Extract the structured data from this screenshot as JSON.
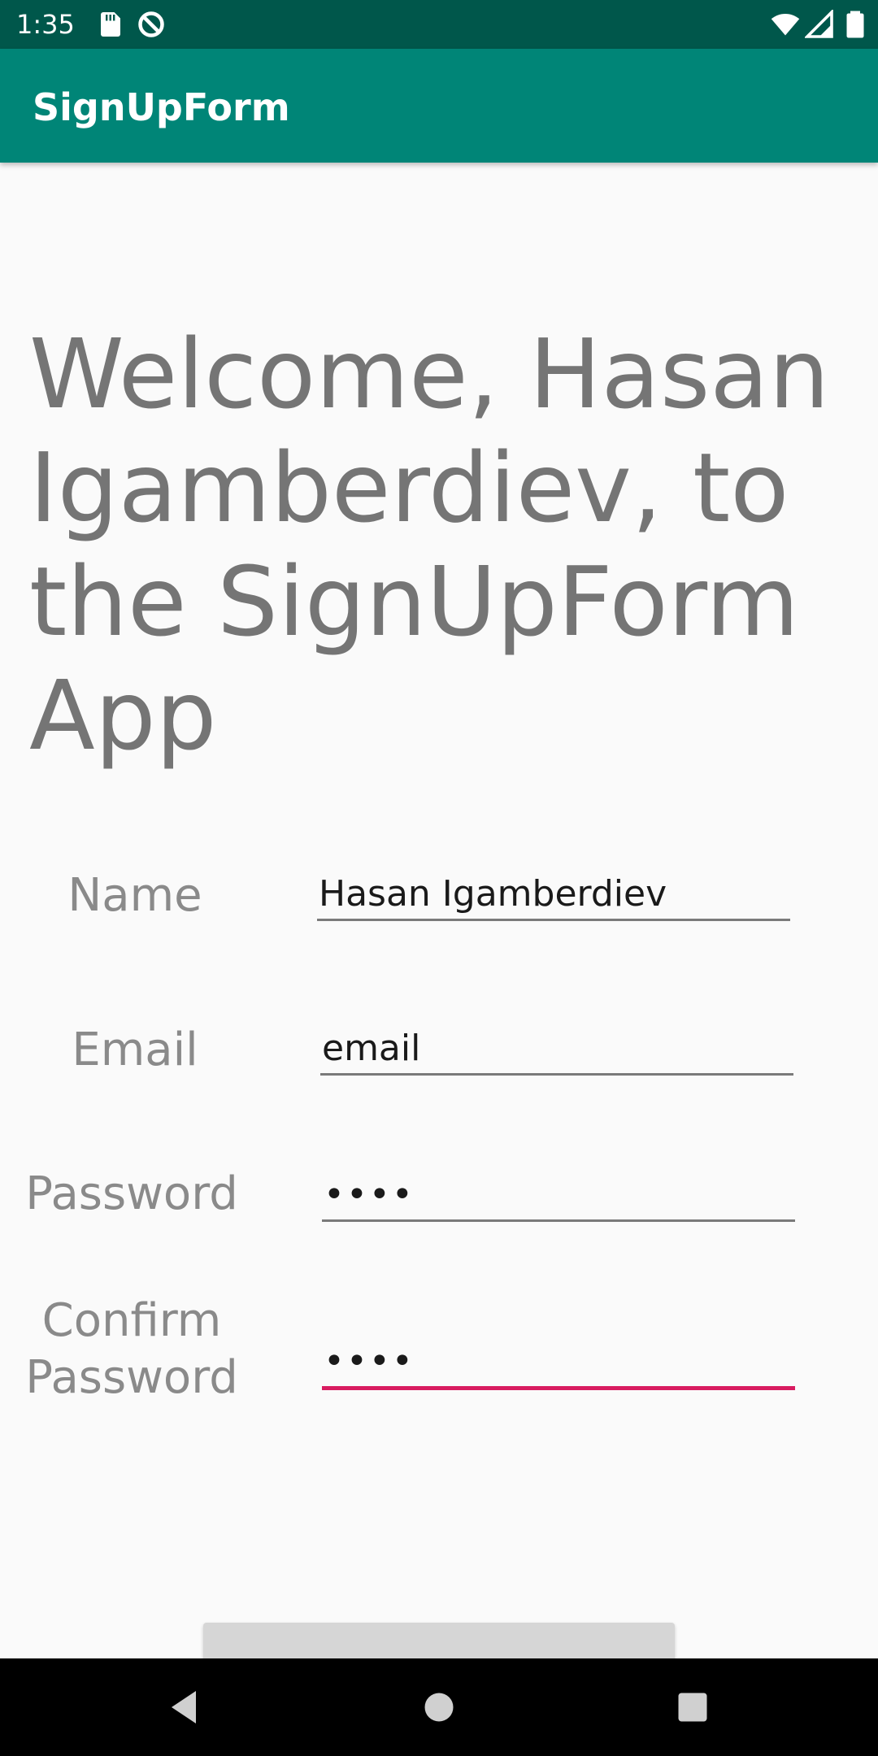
{
  "status_bar": {
    "time": "1:35",
    "icons": [
      "sd-card-icon",
      "data-saver-icon",
      "wifi-icon",
      "cell-signal-icon",
      "battery-icon"
    ]
  },
  "app_bar": {
    "title": "SignUpForm"
  },
  "welcome": {
    "text": "Welcome, Hasan Igamberdiev, to the SignUpForm App"
  },
  "form": {
    "name": {
      "label": "Name",
      "value": "Hasan Igamberdiev"
    },
    "email": {
      "label": "Email",
      "value": "email"
    },
    "password": {
      "label": "Password",
      "value": "••••"
    },
    "confirm_password": {
      "label_line1": "Confirm",
      "label_line2": "Password",
      "value": "••••"
    }
  },
  "colors": {
    "status_bar": "#00574b",
    "app_bar": "#008577",
    "accent": "#d81b60",
    "background": "#fafafa"
  },
  "nav_bar": {
    "icons": [
      "back-icon",
      "home-icon",
      "recents-icon"
    ]
  }
}
